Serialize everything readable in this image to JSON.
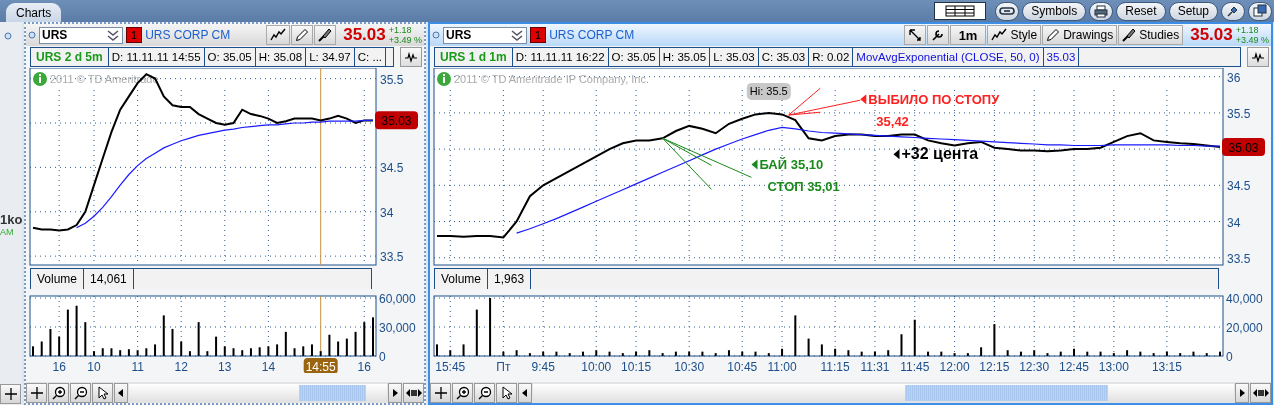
{
  "top_bar": {
    "tab": "Charts",
    "buttons": [
      {
        "kind": "layout"
      },
      {
        "kind": "link"
      },
      {
        "kind": "text",
        "label": "Symbols"
      },
      {
        "kind": "print"
      },
      {
        "kind": "text",
        "label": "Reset"
      },
      {
        "kind": "text",
        "label": "Setup"
      },
      {
        "kind": "pin"
      },
      {
        "kind": "window"
      }
    ]
  },
  "edge_labels": [
    "1ko",
    "AM"
  ],
  "panels": [
    {
      "selected": false,
      "symbol": "URS",
      "link": "1",
      "company": "URS CORP CM",
      "tools": [
        {
          "kind": "style"
        },
        {
          "kind": "drawings"
        },
        {
          "kind": "studies"
        }
      ],
      "price": "35.03",
      "change": "+1.18",
      "change_pct": "+3.49 %",
      "info": {
        "title": "URS 2 d 5m",
        "cells": [
          "D: 11.11.11 14:55",
          "O: 35.05",
          "H: 35.08",
          "L: 34.97",
          "C: ..."
        ]
      },
      "copyright": "2011 © TD Ameritrade",
      "last_price_label": "35.03",
      "cursor_label": "14:55",
      "price_chart": {
        "chart_data": {
          "type": "line",
          "grid": true,
          "ylim": [
            33.4,
            35.62
          ],
          "yticks": [
            33.5,
            34,
            34.5,
            35.5
          ],
          "series": [
            {
              "color": "#000000",
              "values": [
                33.82,
                33.8,
                33.8,
                33.79,
                33.8,
                33.85,
                34.0,
                34.3,
                34.6,
                34.9,
                35.15,
                35.3,
                35.45,
                35.55,
                35.5,
                35.3,
                35.2,
                35.18,
                35.18,
                35.1,
                35.05,
                35.0,
                34.98,
                35.0,
                35.15,
                35.1,
                35.08,
                35.05,
                35.0,
                35.02,
                35.05,
                35.05,
                35.05,
                35.03,
                35.05,
                35.08,
                35.05,
                35.0,
                35.03,
                35.03
              ]
            },
            {
              "color": "#1a1aff",
              "values": [
                null,
                null,
                null,
                null,
                null,
                33.82,
                33.87,
                33.95,
                34.05,
                34.17,
                34.3,
                34.42,
                34.52,
                34.6,
                34.66,
                34.72,
                34.76,
                34.8,
                34.83,
                34.86,
                34.88,
                34.9,
                34.92,
                34.93,
                34.95,
                34.96,
                34.97,
                34.98,
                34.98,
                34.99,
                35.0,
                35.0,
                35.01,
                35.01,
                35.02,
                35.02,
                35.02,
                35.02,
                35.03,
                35.03
              ]
            }
          ]
        }
      },
      "volume": {
        "value": "14,061",
        "chart_data": {
          "type": "bar",
          "grid": true,
          "ylim": [
            0,
            60000
          ],
          "yticks": [
            {
              "value": 0,
              "label": "0"
            },
            {
              "value": 30000,
              "label": "30,000"
            },
            {
              "value": 60000,
              "label": "60,000"
            }
          ],
          "categories": [
            null,
            null,
            null,
            "16",
            null,
            null,
            null,
            "10",
            null,
            null,
            null,
            null,
            "11",
            null,
            null,
            null,
            null,
            "12",
            null,
            null,
            null,
            null,
            "13",
            null,
            null,
            null,
            null,
            "14",
            null,
            null,
            null,
            null,
            null,
            null,
            null,
            null,
            null,
            null,
            "16",
            null
          ],
          "series": [
            {
              "name": "Volume",
              "color": "#000000",
              "values": [
                10000,
                15000,
                28000,
                20000,
                48000,
                52000,
                35000,
                5000,
                8000,
                8000,
                6000,
                7000,
                6000,
                8000,
                12000,
                42000,
                28000,
                15000,
                5000,
                35000,
                5000,
                20000,
                10000,
                8000,
                6000,
                8000,
                9000,
                10000,
                12000,
                25000,
                8000,
                10000,
                12000,
                5000,
                22000,
                15000,
                18000,
                25000,
                35000,
                40000
              ]
            }
          ]
        }
      }
    },
    {
      "selected": true,
      "symbol": "URS",
      "link": "1",
      "company": "URS CORP CM",
      "tools": [
        {
          "kind": "tool"
        },
        {
          "kind": "wrench"
        },
        {
          "kind": "interval",
          "label": "1m"
        },
        {
          "kind": "style",
          "label": "Style"
        },
        {
          "kind": "drawings",
          "label": "Drawings"
        },
        {
          "kind": "studies",
          "label": "Studies"
        }
      ],
      "price": "35.03",
      "change": "+1.18",
      "change_pct": "+3.49 %",
      "info": {
        "title": "URS 1 d 1m",
        "cells": [
          "D: 11.11.11 16:22",
          "O: 35.05",
          "H: 35.05",
          "L: 35.03",
          "C: 35.03",
          "R: 0.02"
        ],
        "study_cells": [
          "MovAvgExponential (CLOSE, 50, 0)",
          "35.03"
        ]
      },
      "copyright": "2011 © TD Ameritrade IP Company, Inc.",
      "last_price_label": "35.03",
      "high_label": "Hi: 35.5",
      "notes": [
        {
          "lines": [
            "ВЫБИЛО ПО СТОПУ",
            "35,42"
          ],
          "color": "#ff2020"
        },
        {
          "lines": [
            "БАЙ 35,10",
            "СТОП 35,01"
          ],
          "color": "#1a8a1a"
        },
        {
          "lines": [
            "+32 цента"
          ],
          "color": "#000000"
        }
      ],
      "price_chart": {
        "chart_data": {
          "type": "line",
          "grid": true,
          "ylim": [
            33.4,
            36.12
          ],
          "yticks": [
            33.5,
            34,
            34.5,
            35.5,
            36
          ],
          "series": [
            {
              "color": "#000000",
              "values": [
                33.8,
                33.8,
                33.79,
                33.8,
                33.8,
                33.78,
                34.0,
                34.35,
                34.5,
                34.6,
                34.7,
                34.8,
                34.9,
                35.0,
                35.08,
                35.12,
                35.12,
                35.15,
                35.25,
                35.32,
                35.28,
                35.22,
                35.35,
                35.42,
                35.48,
                35.5,
                35.48,
                35.4,
                35.15,
                35.12,
                35.18,
                35.2,
                35.2,
                35.18,
                35.18,
                35.2,
                35.2,
                35.12,
                35.08,
                35.05,
                35.08,
                35.1,
                35.02,
                35.0,
                34.98,
                34.98,
                34.97,
                34.98,
                35.0,
                35.0,
                35.02,
                35.1,
                35.18,
                35.22,
                35.12,
                35.1,
                35.08,
                35.07,
                35.05,
                35.03
              ]
            },
            {
              "color": "#1a1aff",
              "values": [
                null,
                null,
                null,
                null,
                null,
                null,
                33.84,
                33.9,
                33.97,
                34.04,
                34.12,
                34.2,
                34.28,
                34.36,
                34.44,
                34.52,
                34.6,
                34.68,
                34.76,
                34.84,
                34.92,
                35.0,
                35.07,
                35.14,
                35.2,
                35.26,
                35.3,
                35.28,
                35.25,
                35.23,
                35.22,
                35.21,
                35.2,
                35.19,
                35.18,
                35.17,
                35.16,
                35.15,
                35.14,
                35.13,
                35.12,
                35.11,
                35.1,
                35.09,
                35.08,
                35.07,
                35.06,
                35.06,
                35.05,
                35.05,
                35.05,
                35.06,
                35.06,
                35.06,
                35.06,
                35.06,
                35.05,
                35.05,
                35.04,
                35.04
              ]
            }
          ]
        }
      },
      "volume": {
        "value": "1,963",
        "chart_data": {
          "type": "bar",
          "grid": true,
          "ylim": [
            0,
            40000
          ],
          "yticks": [
            {
              "value": 0,
              "label": "0"
            },
            {
              "value": 20000,
              "label": "20,000"
            },
            {
              "value": 40000,
              "label": "40,000"
            }
          ],
          "categories": [
            null,
            "15:45",
            null,
            null,
            null,
            "Пт",
            null,
            null,
            "9:45",
            null,
            null,
            null,
            "10:00",
            null,
            null,
            "10:15",
            null,
            null,
            null,
            "10:30",
            null,
            null,
            null,
            "10:45",
            null,
            null,
            "11:00",
            null,
            null,
            null,
            "11:15",
            null,
            null,
            "11:31",
            null,
            null,
            "11:45",
            null,
            null,
            "12:00",
            null,
            null,
            "12:15",
            null,
            null,
            "12:30",
            null,
            null,
            "12:45",
            null,
            null,
            "13:00",
            null,
            null,
            null,
            "13:15",
            null,
            null,
            null,
            null
          ],
          "series": [
            {
              "name": "Volume",
              "color": "#000000",
              "values": [
                8000,
                4000,
                8000,
                32000,
                40000,
                3000,
                4000,
                2000,
                3000,
                3000,
                2000,
                3000,
                4000,
                3000,
                2000,
                3000,
                4000,
                2000,
                3000,
                3000,
                3000,
                2000,
                4000,
                3000,
                3000,
                2000,
                5000,
                28000,
                12000,
                8000,
                5000,
                4000,
                3000,
                3000,
                4000,
                15000,
                25000,
                3000,
                3000,
                2000,
                2000,
                6000,
                22000,
                4000,
                3000,
                4000,
                2000,
                3000,
                5000,
                3000,
                3000,
                2000,
                4000,
                3000,
                2000,
                3000,
                2000,
                3000,
                2000,
                3000
              ]
            }
          ]
        }
      }
    }
  ]
}
